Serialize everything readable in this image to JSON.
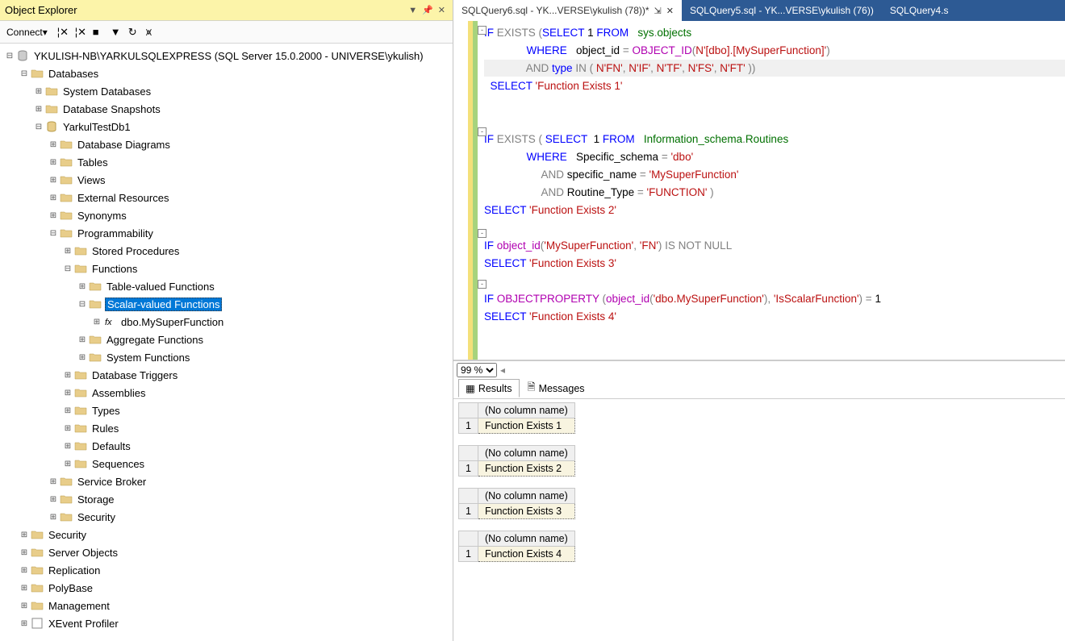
{
  "object_explorer": {
    "title": "Object Explorer",
    "connect_label": "Connect",
    "tree": [
      {
        "indent": 0,
        "exp": "-",
        "icon": "server",
        "label": "YKULISH-NB\\YARKULSQLEXPRESS (SQL Server 15.0.2000 - UNIVERSE\\ykulish)"
      },
      {
        "indent": 1,
        "exp": "-",
        "icon": "folder",
        "label": "Databases"
      },
      {
        "indent": 2,
        "exp": "+",
        "icon": "folder",
        "label": "System Databases"
      },
      {
        "indent": 2,
        "exp": "+",
        "icon": "folder",
        "label": "Database Snapshots"
      },
      {
        "indent": 2,
        "exp": "-",
        "icon": "db",
        "label": "YarkulTestDb1"
      },
      {
        "indent": 3,
        "exp": "+",
        "icon": "folder",
        "label": "Database Diagrams"
      },
      {
        "indent": 3,
        "exp": "+",
        "icon": "folder",
        "label": "Tables"
      },
      {
        "indent": 3,
        "exp": "+",
        "icon": "folder",
        "label": "Views"
      },
      {
        "indent": 3,
        "exp": "+",
        "icon": "folder",
        "label": "External Resources"
      },
      {
        "indent": 3,
        "exp": "+",
        "icon": "folder",
        "label": "Synonyms"
      },
      {
        "indent": 3,
        "exp": "-",
        "icon": "folder",
        "label": "Programmability"
      },
      {
        "indent": 4,
        "exp": "+",
        "icon": "folder",
        "label": "Stored Procedures"
      },
      {
        "indent": 4,
        "exp": "-",
        "icon": "folder",
        "label": "Functions"
      },
      {
        "indent": 5,
        "exp": "+",
        "icon": "folder",
        "label": "Table-valued Functions"
      },
      {
        "indent": 5,
        "exp": "-",
        "icon": "folder",
        "label": "Scalar-valued Functions",
        "selected": true
      },
      {
        "indent": 6,
        "exp": "+",
        "icon": "fn",
        "label": "dbo.MySuperFunction"
      },
      {
        "indent": 5,
        "exp": "+",
        "icon": "folder",
        "label": "Aggregate Functions"
      },
      {
        "indent": 5,
        "exp": "+",
        "icon": "folder",
        "label": "System Functions"
      },
      {
        "indent": 4,
        "exp": "+",
        "icon": "folder",
        "label": "Database Triggers"
      },
      {
        "indent": 4,
        "exp": "+",
        "icon": "folder",
        "label": "Assemblies"
      },
      {
        "indent": 4,
        "exp": "+",
        "icon": "folder",
        "label": "Types"
      },
      {
        "indent": 4,
        "exp": "+",
        "icon": "folder",
        "label": "Rules"
      },
      {
        "indent": 4,
        "exp": "+",
        "icon": "folder",
        "label": "Defaults"
      },
      {
        "indent": 4,
        "exp": "+",
        "icon": "folder",
        "label": "Sequences"
      },
      {
        "indent": 3,
        "exp": "+",
        "icon": "folder",
        "label": "Service Broker"
      },
      {
        "indent": 3,
        "exp": "+",
        "icon": "folder",
        "label": "Storage"
      },
      {
        "indent": 3,
        "exp": "+",
        "icon": "folder",
        "label": "Security"
      },
      {
        "indent": 1,
        "exp": "+",
        "icon": "folder",
        "label": "Security"
      },
      {
        "indent": 1,
        "exp": "+",
        "icon": "folder",
        "label": "Server Objects"
      },
      {
        "indent": 1,
        "exp": "+",
        "icon": "folder",
        "label": "Replication"
      },
      {
        "indent": 1,
        "exp": "+",
        "icon": "folder",
        "label": "PolyBase"
      },
      {
        "indent": 1,
        "exp": "+",
        "icon": "folder",
        "label": "Management"
      },
      {
        "indent": 1,
        "exp": "+",
        "icon": "xe",
        "label": "XEvent Profiler"
      }
    ]
  },
  "tabs": [
    {
      "label": "SQLQuery6.sql - YK...VERSE\\ykulish (78))*",
      "active": true,
      "pinned": true,
      "closeable": true
    },
    {
      "label": "SQLQuery5.sql - YK...VERSE\\ykulish (76))",
      "active": false
    },
    {
      "label": "SQLQuery4.s",
      "active": false
    }
  ],
  "code": {
    "l1a": "IF",
    "l1b": " EXISTS ",
    "l1c": "(",
    "l1d": "SELECT",
    "l1e": " 1 ",
    "l1f": "FROM",
    "l1g": "   sys",
    "l1h": ".",
    "l1i": "objects",
    "l2a": "              ",
    "l2b": "WHERE",
    "l2c": "   object_id ",
    "l2d": "=",
    "l2e": " OBJECT_ID",
    "l2f": "(",
    "l2g": "N'[dbo].[MySuperFunction]'",
    "l2h": ")",
    "l3a": "              ",
    "l3b": "AND",
    "l3c": " type ",
    "l3d": "IN",
    "l3e": " ",
    "l3f": "(",
    "l3g": " N'FN'",
    "l3h": ",",
    "l3i": " N'IF'",
    "l3j": ",",
    "l3k": " N'TF'",
    "l3l": ",",
    "l3m": " N'FS'",
    "l3n": ",",
    "l3o": " N'FT'",
    "l3p": " ))",
    "l4a": "  ",
    "l4b": "SELECT",
    "l4c": " 'Function Exists 1'",
    "blank": " ",
    "l7a": "IF",
    "l7b": " EXISTS ",
    "l7c": "( ",
    "l7d": "SELECT",
    "l7e": "  1 ",
    "l7f": "FROM",
    "l7g": "   Information_schema",
    "l7h": ".",
    "l7i": "Routines",
    "l8a": "              ",
    "l8b": "WHERE",
    "l8c": "   Specific_schema ",
    "l8d": "=",
    "l8e": " 'dbo'",
    "l9a": "                   ",
    "l9b": "AND",
    "l9c": " specific_name ",
    "l9d": "=",
    "l9e": " 'MySuperFunction'",
    "l10a": "                   ",
    "l10b": "AND",
    "l10c": " Routine_Type ",
    "l10d": "=",
    "l10e": " 'FUNCTION'",
    "l10f": " )",
    "l11a": "SELECT",
    "l11b": " 'Function Exists 2'",
    "l13a": "IF",
    "l13b": " object_id",
    "l13c": "(",
    "l13d": "'MySuperFunction'",
    "l13e": ",",
    "l13f": " 'FN'",
    "l13g": ")",
    "l13h": " IS NOT NULL",
    "l14a": "SELECT",
    "l14b": " 'Function Exists 3'",
    "l16a": "IF",
    "l16b": " OBJECTPROPERTY ",
    "l16c": "(",
    "l16d": "object_id",
    "l16e": "(",
    "l16f": "'dbo.MySuperFunction'",
    "l16g": ")",
    "l16h": ",",
    "l16i": " 'IsScalarFunction'",
    "l16j": ")",
    "l16k": " = ",
    "l16l": "1",
    "l17a": "SELECT",
    "l17b": " 'Function Exists 4'"
  },
  "zoom": "99 %",
  "result_tabs": {
    "results": "Results",
    "messages": "Messages"
  },
  "results": [
    {
      "header": "(No column name)",
      "row": "1",
      "value": "Function Exists 1"
    },
    {
      "header": "(No column name)",
      "row": "1",
      "value": "Function Exists 2"
    },
    {
      "header": "(No column name)",
      "row": "1",
      "value": "Function Exists 3"
    },
    {
      "header": "(No column name)",
      "row": "1",
      "value": "Function Exists 4"
    }
  ]
}
